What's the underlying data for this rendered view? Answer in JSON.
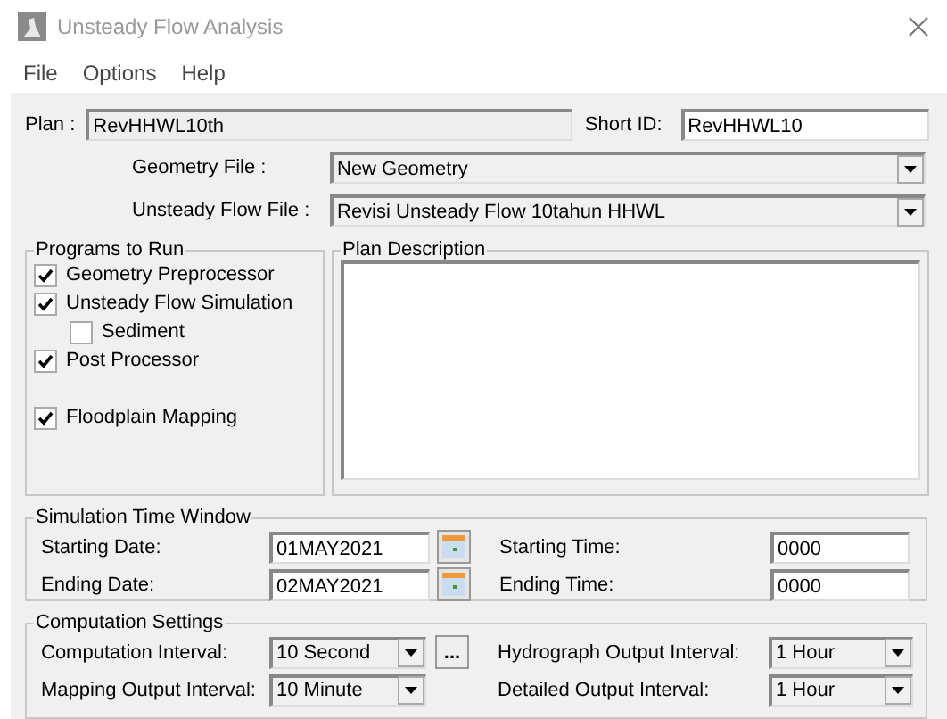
{
  "window": {
    "title": "Unsteady Flow Analysis"
  },
  "menu": [
    "File",
    "Options",
    "Help"
  ],
  "plan": {
    "label": "Plan :",
    "value": "RevHHWL10th"
  },
  "short_id": {
    "label": "Short ID:",
    "value": "RevHHWL10"
  },
  "files": [
    {
      "label": "Geometry File :",
      "value": "New Geometry"
    },
    {
      "label": "Unsteady Flow File :",
      "value": "Revisi Unsteady Flow 10tahun HHWL"
    }
  ],
  "programs_to_run": {
    "title": "Programs to Run",
    "items": [
      {
        "label": "Geometry Preprocessor",
        "checked": true
      },
      {
        "label": "Unsteady Flow Simulation",
        "checked": true,
        "children": [
          {
            "label": "Sediment",
            "checked": false
          }
        ]
      },
      {
        "label": "Post Processor",
        "checked": true
      },
      {
        "label": "Floodplain Mapping",
        "checked": true
      }
    ]
  },
  "plan_description": {
    "title": "Plan Description"
  },
  "simulation_time_window": {
    "title": "Simulation Time Window",
    "rows": [
      {
        "date_label": "Starting Date:",
        "date": "01MAY2021",
        "time_label": "Starting Time:",
        "time": "0000"
      },
      {
        "date_label": "Ending Date:",
        "date": "02MAY2021",
        "time_label": "Ending Time:",
        "time": "0000"
      }
    ]
  },
  "computation_settings": {
    "title": "Computation Settings",
    "more_button": "...",
    "rows": [
      {
        "label": "Computation Interval:",
        "value": "10 Second",
        "right_label": "Hydrograph Output Interval:",
        "right_value": "1 Hour"
      },
      {
        "label": "Mapping Output Interval:",
        "value": "10 Minute",
        "right_label": "Detailed Output Interval:",
        "right_value": "1 Hour"
      }
    ]
  }
}
